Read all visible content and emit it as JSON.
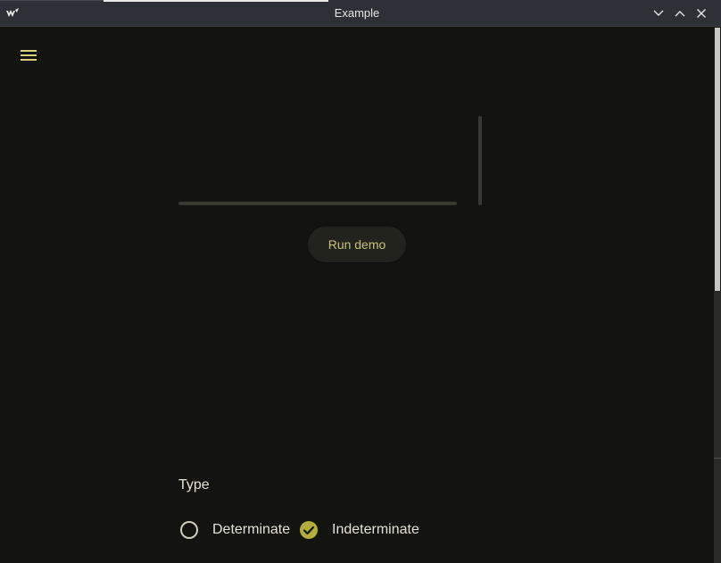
{
  "window": {
    "title": "Example",
    "controls": {
      "minimize": "chevron-down-icon",
      "maximize": "chevron-up-icon",
      "close": "close-icon"
    }
  },
  "app": {
    "menu_icon": "hamburger-menu-icon",
    "run_demo_label": "Run demo",
    "linear_progress_value": 0,
    "vertical_progress_value": 0
  },
  "type_section": {
    "heading": "Type",
    "options": [
      {
        "label": "Determinate",
        "selected": false
      },
      {
        "label": "Indeterminate",
        "selected": true
      }
    ]
  },
  "colors": {
    "background": "#131310",
    "accent": "#b3ae3a",
    "button_text": "#c9c179",
    "titlebar": "#2d3036"
  }
}
